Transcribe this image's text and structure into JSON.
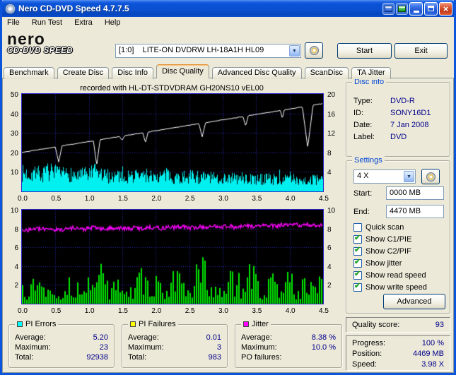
{
  "window": {
    "title": "Nero CD-DVD Speed 4.7.7.5",
    "menu": [
      "File",
      "Run Test",
      "Extra",
      "Help"
    ],
    "logo": {
      "line1": "nero",
      "line2": "CD•DVD SPEED"
    },
    "drive_combo": "[1:0]    LITE-ON DVDRW LH-18A1H HL09",
    "start_button": "Start",
    "exit_button": "Exit"
  },
  "tabs": [
    "Benchmark",
    "Create Disc",
    "Disc Info",
    "Disc Quality",
    "Advanced Disc Quality",
    "ScanDisc",
    "TA Jitter"
  ],
  "active_tab": "Disc Quality",
  "disc_info": {
    "title": "Disc info",
    "rows": [
      {
        "label": "Type:",
        "value": "DVD-R"
      },
      {
        "label": "ID:",
        "value": "SONY16D1"
      },
      {
        "label": "Date:",
        "value": "7 Jan 2008"
      },
      {
        "label": "Label:",
        "value": "DVD"
      }
    ]
  },
  "settings": {
    "title": "Settings",
    "speed_select": "4 X",
    "start_label": "Start:",
    "start_value": "0000 MB",
    "end_label": "End:",
    "end_value": "4470 MB",
    "checkboxes": [
      {
        "label": "Quick scan",
        "checked": false
      },
      {
        "label": "Show C1/PIE",
        "checked": true
      },
      {
        "label": "Show C2/PIF",
        "checked": true
      },
      {
        "label": "Show jitter",
        "checked": true
      },
      {
        "label": "Show read speed",
        "checked": true
      },
      {
        "label": "Show write speed",
        "checked": true
      }
    ],
    "advanced_button": "Advanced"
  },
  "quality": {
    "label": "Quality score:",
    "value": "93"
  },
  "progress": {
    "rows": [
      {
        "label": "Progress:",
        "value": "100 %"
      },
      {
        "label": "Position:",
        "value": "4469 MB"
      },
      {
        "label": "Speed:",
        "value": "3.98 X"
      }
    ]
  },
  "stats": [
    {
      "title": "PI Errors",
      "color": "#00FFFF",
      "rows": [
        {
          "label": "Average:",
          "value": "5.20"
        },
        {
          "label": "Maximum:",
          "value": "23"
        },
        {
          "label": "Total:",
          "value": "92938"
        }
      ]
    },
    {
      "title": "PI Failures",
      "color": "#FFFF00",
      "rows": [
        {
          "label": "Average:",
          "value": "0.01"
        },
        {
          "label": "Maximum:",
          "value": "3"
        },
        {
          "label": "Total:",
          "value": "983"
        }
      ]
    },
    {
      "title": "Jitter",
      "color": "#FF00FF",
      "rows": [
        {
          "label": "Average:",
          "value": "8.38 %"
        },
        {
          "label": "Maximum:",
          "value": "10.0 %"
        },
        {
          "label": "PO failures:",
          "value": ""
        }
      ]
    }
  ],
  "chart_data": [
    {
      "type": "area",
      "title": "recorded with HL-DT-STDVDRAM GH20NS10  vEL00",
      "seed": 7,
      "x_axis": {
        "min": 0,
        "max": 4.5,
        "ticks": [
          "0.0",
          "0.5",
          "1.0",
          "1.5",
          "2.0",
          "2.5",
          "3.0",
          "3.5",
          "4.0",
          "4.5"
        ]
      },
      "y_left": {
        "min": 0,
        "max": 50,
        "ticks": [
          50,
          40,
          30,
          20,
          10
        ]
      },
      "y_right": {
        "min": 0,
        "max": 20,
        "ticks": [
          20,
          16,
          12,
          8,
          4
        ]
      },
      "grid": true,
      "series": [
        {
          "name": "C1/PIE errors",
          "type": "area",
          "color": "#00F0F0",
          "axis": "left",
          "points": [
            9.5,
            9,
            10,
            8.5,
            10.5,
            9,
            8.5,
            9.5,
            8,
            8.5,
            9,
            10,
            8.5,
            8,
            8.5,
            9,
            7.5,
            8.5,
            8,
            8.5,
            7.5,
            8,
            8.5,
            7.5,
            7,
            7.5,
            8,
            7,
            7.5,
            6.5,
            7,
            7.5,
            6.5,
            7,
            6.5,
            6,
            6.5,
            7,
            6,
            6.5,
            6,
            6.5,
            6,
            5.5,
            6,
            5.5
          ]
        },
        {
          "name": "write speed",
          "type": "line",
          "color": "#FFFFFF",
          "axis": "right",
          "start": 8,
          "end": 18,
          "dips": [
            {
              "x": 0.55,
              "v": 6,
              "w": 0.05
            },
            {
              "x": 1.12,
              "v": 5.4,
              "w": 0.05
            },
            {
              "x": 1.5,
              "v": 10.5,
              "w": 0.04
            },
            {
              "x": 1.85,
              "v": 10,
              "w": 0.04
            },
            {
              "x": 2.7,
              "v": 11.2,
              "w": 0.05
            },
            {
              "x": 3.35,
              "v": 13.4,
              "w": 0.04
            },
            {
              "x": 3.9,
              "v": 15,
              "w": 0.03
            },
            {
              "x": 4.28,
              "v": 9,
              "w": 0.08
            }
          ]
        }
      ]
    },
    {
      "type": "bar",
      "seed": 13,
      "x_axis": {
        "min": 0,
        "max": 4.5,
        "ticks": [
          "0.0",
          "0.5",
          "1.0",
          "1.5",
          "2.0",
          "2.5",
          "3.0",
          "3.5",
          "4.0",
          "4.5"
        ]
      },
      "y_left": {
        "min": 0,
        "max": 10,
        "ticks": [
          10,
          8,
          6,
          4,
          2
        ]
      },
      "y_right": {
        "min": 0,
        "max": 10,
        "ticks": [
          10,
          8,
          6,
          4,
          2
        ]
      },
      "grid": true,
      "series": [
        {
          "name": "C2/PIF failures",
          "type": "bars",
          "color": "#00E400",
          "axis": "left",
          "points": [
            2,
            1,
            3,
            1.5,
            2,
            1,
            1.5,
            2,
            1,
            3,
            2,
            1.5,
            5.5,
            1,
            2,
            1.5,
            1,
            2,
            3,
            1.5,
            2,
            1,
            1.5,
            3,
            2,
            1,
            2,
            4,
            1.5,
            2,
            1,
            3,
            2,
            1.5,
            5,
            2,
            1,
            2,
            1.5,
            2,
            3,
            1,
            2,
            1.5,
            3,
            2
          ]
        },
        {
          "name": "jitter",
          "type": "line",
          "color": "#FF00FF",
          "axis": "left",
          "points": [
            7.9,
            7.85,
            8.0,
            7.9,
            8.05,
            7.85,
            7.9,
            8.0,
            8.1,
            7.9,
            8.0,
            8.15,
            7.9,
            8.0,
            8.1,
            8.0,
            7.95,
            8.1,
            8.0,
            8.15,
            8.1,
            8.0,
            8.2,
            8.1,
            8.25,
            8.05,
            8.1,
            8.2,
            8.1,
            8.3,
            8.2,
            8.3,
            8.1,
            8.2,
            8.3,
            8.2,
            8.35,
            8.3,
            8.25,
            8.4,
            8.3,
            8.45,
            8.3,
            8.4,
            8.35,
            8.4
          ]
        }
      ]
    }
  ]
}
